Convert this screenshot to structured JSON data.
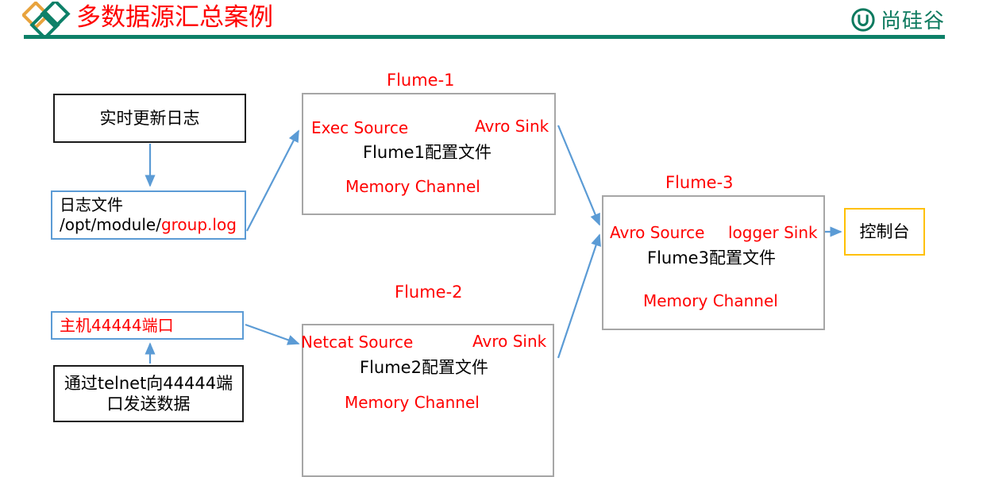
{
  "header": {
    "title": "多数据源汇总案例",
    "title_color": "#ff0000",
    "brand_text": "尚硅谷",
    "brand_color": "#0d7a5f",
    "rule_color": "#0d8068",
    "logo_icon": "diamonds-icon",
    "brand_icon": "atguigu-u-logo-icon"
  },
  "nodes": {
    "realtime_log": {
      "label": "实时更新日志",
      "border_color": "#1a1a1a"
    },
    "log_file": {
      "line1": "日志文件",
      "line2_prefix": "/opt/module/",
      "line2_highlight": "group.log",
      "highlight_color": "#ff0000",
      "border_color": "#5b9bd5"
    },
    "host_port": {
      "label": "主机44444端口",
      "text_color": "#ff0000",
      "border_color": "#5b9bd5"
    },
    "telnet_send": {
      "line1": "通过telnet向44444端",
      "line2": "口发送数据",
      "border_color": "#1a1a1a"
    },
    "console": {
      "label": "控制台",
      "border_color": "#ffc000"
    }
  },
  "flume1": {
    "title": "Flume-1",
    "source": "Exec Source",
    "sink": "Avro Sink",
    "config": "Flume1配置文件",
    "channel": "Memory  Channel",
    "border_color": "#a6a6a6",
    "title_color": "#ff0000"
  },
  "flume2": {
    "title": "Flume-2",
    "source": "Netcat Source",
    "sink": "Avro Sink",
    "config": "Flume2配置文件",
    "channel": "Memory  Channel",
    "border_color": "#a6a6a6",
    "title_color": "#ff0000"
  },
  "flume3": {
    "title": "Flume-3",
    "source": "Avro Source",
    "sink": "logger Sink",
    "config": "Flume3配置文件",
    "channel": "Memory Channel",
    "border_color": "#a6a6a6",
    "title_color": "#ff0000"
  },
  "edges": {
    "arrow_color": "#5b9bd5",
    "dashed_color": "#5b9bd5"
  }
}
